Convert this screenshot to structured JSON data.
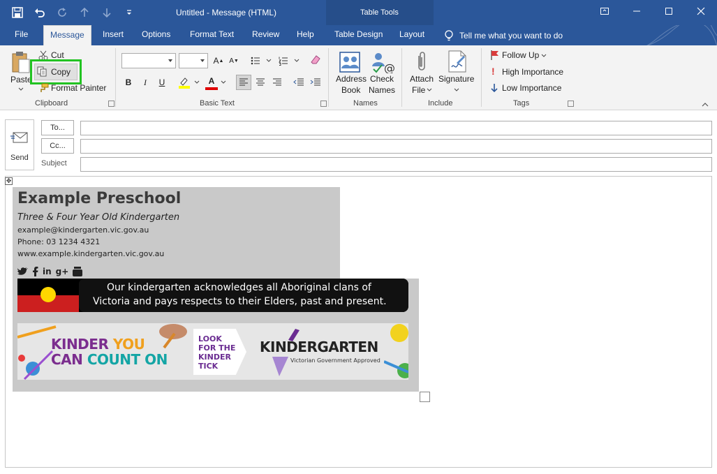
{
  "window": {
    "title": "Untitled  -  Message (HTML)",
    "contextual_tab_group": "Table Tools"
  },
  "tabs": [
    {
      "label": "File"
    },
    {
      "label": "Message"
    },
    {
      "label": "Insert"
    },
    {
      "label": "Options"
    },
    {
      "label": "Format Text"
    },
    {
      "label": "Review"
    },
    {
      "label": "Help"
    },
    {
      "label": "Table Design"
    },
    {
      "label": "Layout"
    }
  ],
  "tell_me": "Tell me what you want to do",
  "ribbon": {
    "clipboard": {
      "label": "Clipboard",
      "paste": "Paste",
      "cut": "Cut",
      "copy": "Copy",
      "format_painter": "Format Painter"
    },
    "basic_text": {
      "label": "Basic Text",
      "bold": "B",
      "italic": "I",
      "underline": "U",
      "font_color": "A"
    },
    "names": {
      "label": "Names",
      "address_book_1": "Address",
      "address_book_2": "Book",
      "check_names_1": "Check",
      "check_names_2": "Names"
    },
    "include": {
      "label": "Include",
      "attach_file_1": "Attach",
      "attach_file_2": "File",
      "signature": "Signature"
    },
    "tags": {
      "label": "Tags",
      "follow_up": "Follow Up",
      "high_importance": "High Importance",
      "low_importance": "Low Importance"
    }
  },
  "compose": {
    "send": "Send",
    "to_button": "To...",
    "cc_button": "Cc...",
    "subject_label": "Subject",
    "to_value": "",
    "cc_value": "",
    "subject_value": ""
  },
  "signature": {
    "name": "Example Preschool",
    "tagline": "Three & Four Year Old Kindergarten",
    "email": "example@kindergarten.vic.gov.au",
    "phone": "Phone: 03 1234 4321",
    "website": "www.example.kindergarten.vic.gov.au",
    "acknowledgement_line1": "Our kindergarten acknowledges all Aboriginal clans of",
    "acknowledgement_line2": "Victoria and pays respects to their Elders, past and present.",
    "banner": {
      "kinder_you_a": "KINDER ",
      "kinder_you_b": "YOU",
      "count_on_a": "CAN ",
      "count_on_b": "COUNT ON",
      "tick_1": "LOOK",
      "tick_2": "FOR THE",
      "tick_3": "KINDER",
      "tick_4": "TICK",
      "kindergarten": "KINDERGARTEN",
      "approved": "Victorian Government Approved"
    }
  },
  "colors": {
    "office_blue": "#2b579a",
    "highlight_green": "#22c322",
    "signature_bg": "#c9c9c9"
  }
}
